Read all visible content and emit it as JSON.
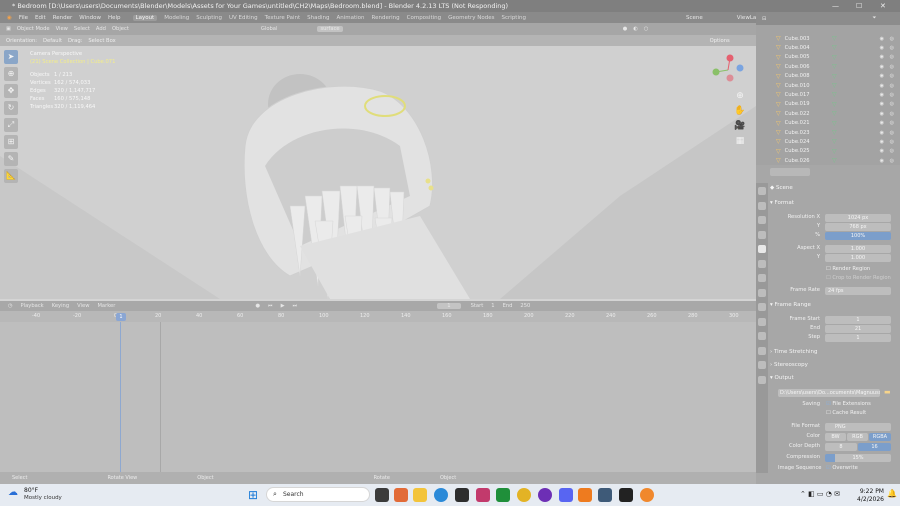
{
  "window": {
    "title": "* Bedroom [D:\\Users\\users\\Documents\\Blender\\Models\\Assets for Your Games\\untitled\\CH2\\Maps\\Bedroom.blend] - Blender 4.2.13 LTS (Not Responding)"
  },
  "menu": [
    "File",
    "Edit",
    "Render",
    "Window",
    "Help"
  ],
  "workspaces": [
    "Layout",
    "Modeling",
    "Sculpting",
    "UV Editing",
    "Texture Paint",
    "Shading",
    "Animation",
    "Rendering",
    "Compositing",
    "Geometry Nodes",
    "Scripting"
  ],
  "scene_label": "Scene",
  "viewlayer_label": "ViewLayer",
  "header": {
    "mode": "Object Mode",
    "view": "View",
    "select": "Select",
    "add": "Add",
    "object": "Object",
    "orientation": "Global",
    "search": "surface"
  },
  "header2": {
    "orientation": "Orientation:",
    "default": "Default",
    "drag": "Drag:",
    "select_box": "Select Box",
    "options": "Options"
  },
  "viewport": {
    "camera": "Camera Perspective",
    "collection": "(21) Scene Collection | Cube.071"
  },
  "stats": [
    {
      "k": "Objects",
      "v": "1 / 213"
    },
    {
      "k": "Vertices",
      "v": "162 / 574,033"
    },
    {
      "k": "Edges",
      "v": "320 / 1,147,717"
    },
    {
      "k": "Faces",
      "v": "160 / 575,148"
    },
    {
      "k": "Triangles",
      "v": "320 / 1,119,464"
    }
  ],
  "timeline": {
    "playback": "Playback",
    "keying": "Keying",
    "view": "View",
    "marker": "Marker",
    "current": "1",
    "start_label": "Start",
    "start": "1",
    "end_label": "End",
    "end": "250"
  },
  "ruler": [
    "-40",
    "-20",
    "0",
    "20",
    "40",
    "60",
    "80",
    "100",
    "120",
    "140",
    "160",
    "180",
    "200",
    "220",
    "240",
    "260",
    "280",
    "300"
  ],
  "status": [
    "Select",
    "Rotate View",
    "Object",
    "Rotate",
    "Object",
    "Blender 4.2.13"
  ],
  "outliner": [
    "Cube.003",
    "Cube.004",
    "Cube.005",
    "Cube.006",
    "Cube.008",
    "Cube.010",
    "Cube.017",
    "Cube.019",
    "Cube.022",
    "Cube.021",
    "Cube.023",
    "Cube.024",
    "Cube.025",
    "Cube.026"
  ],
  "props": {
    "scene": "Scene",
    "format": "Format",
    "resx_label": "Resolution X",
    "resx": "1024 px",
    "resy_label": "Y",
    "resy": "768 px",
    "pct_label": "%",
    "pct": "100%",
    "aspx_label": "Aspect X",
    "aspx": "1.000",
    "aspy_label": "Y",
    "aspy": "1.000",
    "render_region": "Render Region",
    "crop": "Crop to Render Region",
    "fps_label": "Frame Rate",
    "fps": "24 fps",
    "frame_range": "Frame Range",
    "fstart_label": "Frame Start",
    "fstart": "1",
    "fend_label": "End",
    "fend": "21",
    "fstep_label": "Step",
    "fstep": "1",
    "time_stretching": "Time Stretching",
    "stereoscopy": "Stereoscopy",
    "output": "Output",
    "path": "D:\\Users\\users\\Do...ocuments\\Magnuussen\\",
    "saving": "Saving",
    "file_ext": "File Extensions",
    "cache": "Cache Result",
    "fileformat_label": "File Format",
    "fileformat": "PNG",
    "color_label": "Color",
    "bw": "BW",
    "rgb": "RGB",
    "rgba": "RGBA",
    "depth_label": "Color Depth",
    "d8": "8",
    "d16": "16",
    "comp_label": "Compression",
    "comp": "15%",
    "seq_label": "Image Sequence",
    "overwrite": "Overwrite"
  },
  "taskbar": {
    "temp": "80°F",
    "weather": "Mostly cloudy",
    "search": "Search",
    "time": "9:22 PM",
    "date": "4/2/2026"
  }
}
